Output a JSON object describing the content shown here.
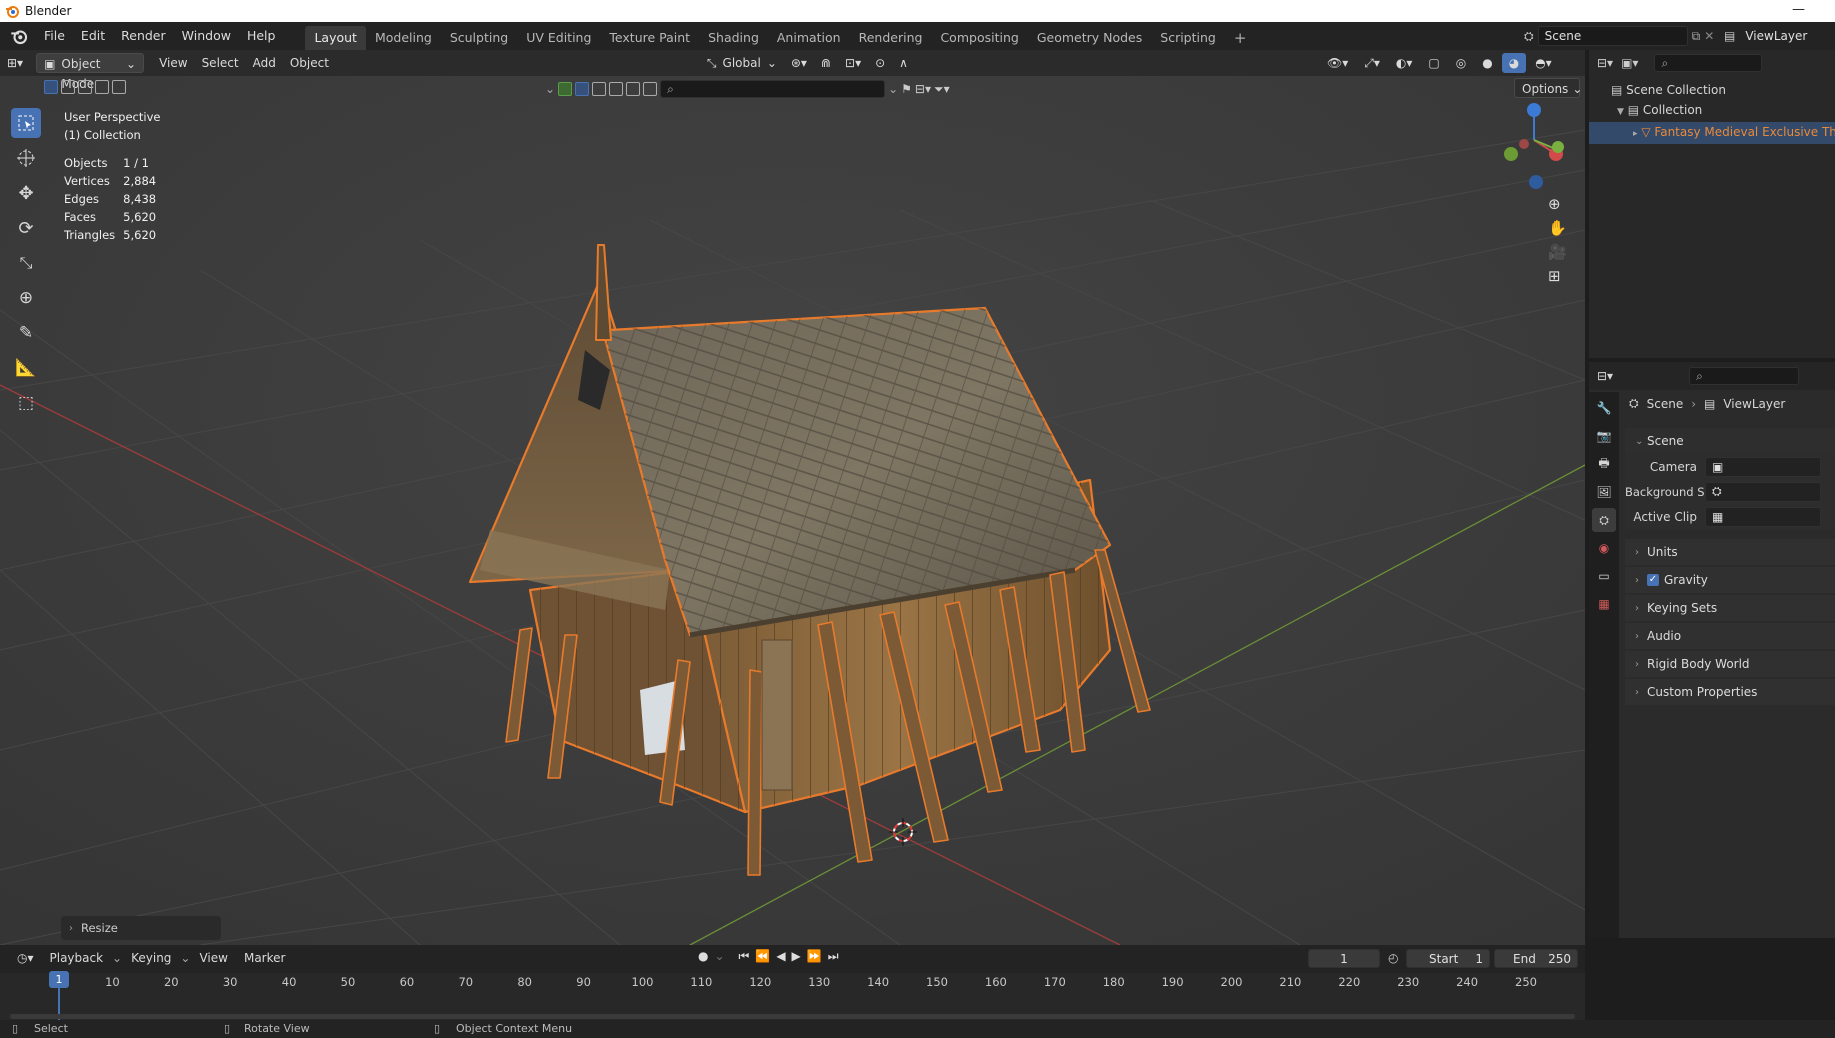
{
  "window": {
    "title": "Blender",
    "minimize_glyph": "—"
  },
  "menu": [
    "File",
    "Edit",
    "Render",
    "Window",
    "Help"
  ],
  "workspaces": [
    "Layout",
    "Modeling",
    "Sculpting",
    "UV Editing",
    "Texture Paint",
    "Shading",
    "Animation",
    "Rendering",
    "Compositing",
    "Geometry Nodes",
    "Scripting"
  ],
  "workspace_add": "+",
  "active_workspace": "Layout",
  "scene_field": "Scene",
  "viewlayer_field": "ViewLayer",
  "viewport_header": {
    "mode": "Object Mode",
    "menus": [
      "View",
      "Select",
      "Add",
      "Object"
    ],
    "orientation": "Global",
    "options": "Options"
  },
  "overlay_info": {
    "perspective": "User Perspective",
    "collection": "(1) Collection",
    "stats": [
      {
        "label": "Objects",
        "value": "1 / 1"
      },
      {
        "label": "Vertices",
        "value": "2,884"
      },
      {
        "label": "Edges",
        "value": "8,438"
      },
      {
        "label": "Faces",
        "value": "5,620"
      },
      {
        "label": "Triangles",
        "value": "5,620"
      }
    ]
  },
  "last_operator": "Resize",
  "outliner": {
    "scene_collection": "Scene Collection",
    "collection": "Collection",
    "object": "Fantasy Medieval Exclusive Thatch"
  },
  "properties": {
    "breadcrumb": [
      "Scene",
      "ViewLayer"
    ],
    "section": "Scene",
    "fields": [
      {
        "label": "Camera"
      },
      {
        "label": "Background Scene"
      },
      {
        "label": "Active Clip"
      }
    ],
    "panels": [
      "Units",
      "Gravity",
      "Keying Sets",
      "Audio",
      "Rigid Body World",
      "Custom Properties"
    ],
    "gravity_checked": true
  },
  "timeline": {
    "menus": [
      "Playback",
      "Keying",
      "View",
      "Marker"
    ],
    "current_frame": "1",
    "start_label": "Start",
    "start": "1",
    "end_label": "End",
    "end": "250",
    "ticks": [
      "10",
      "20",
      "30",
      "40",
      "50",
      "60",
      "70",
      "80",
      "90",
      "100",
      "110",
      "120",
      "130",
      "140",
      "150",
      "160",
      "170",
      "180",
      "190",
      "200",
      "210",
      "220",
      "230",
      "240",
      "250"
    ],
    "playhead": "1"
  },
  "statusbar": {
    "items": [
      "Select",
      "Rotate View",
      "Object Context Menu"
    ]
  },
  "colors": {
    "accent": "#4772b3",
    "selection_outline": "#e87a2c",
    "x_axis": "#c84a4a",
    "y_axis": "#7ab040",
    "z_axis": "#3b7bd6"
  }
}
